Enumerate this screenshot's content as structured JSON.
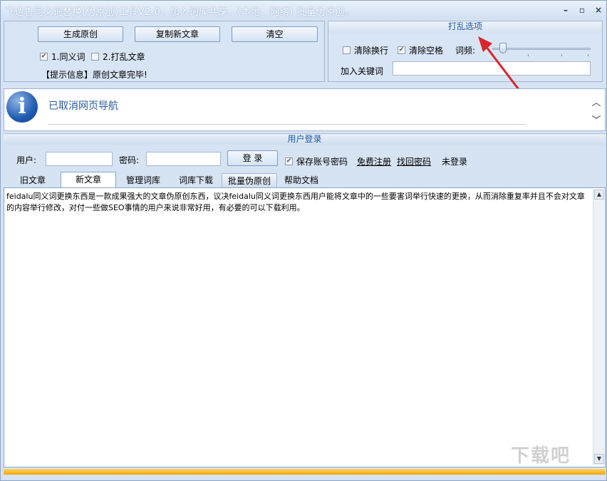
{
  "window": {
    "title": "飞达鲁同义词替换(伪原创)工具V2.0，加入词库共享、(本地、网络) 批量伪原创。",
    "minimize": "–",
    "maximize": "▫",
    "close": "×"
  },
  "actions": {
    "generate": "生成原创",
    "copy_new": "复制新文章",
    "clear": "清空"
  },
  "options": {
    "synonym_label": "1.同义词",
    "synonym_checked": true,
    "shuffle_label": "2.打乱文章",
    "shuffle_checked": false
  },
  "hint": "【提示信息】原创文章完毕!",
  "shuffle_panel": {
    "title": "打乱选项",
    "remove_newline": "清除换行",
    "remove_newline_checked": false,
    "remove_space": "清除空格",
    "remove_space_checked": true,
    "frequency_label": "词频:",
    "frequency_level": 0.1,
    "keyword_label": "加入关键词",
    "keyword_value": ""
  },
  "info": {
    "icon": "info-icon",
    "message": "已取消网页导航"
  },
  "login": {
    "header": "用户登录",
    "user_label": "用户:",
    "user_value": "",
    "password_label": "密码:",
    "password_value": "",
    "login_button": "登 录",
    "remember_label": "保存账号密码",
    "remember_checked": true,
    "register_link": "免费注册",
    "recover_link": "找回密码",
    "status": "未登录"
  },
  "tabs": [
    {
      "label": "旧文章"
    },
    {
      "label": "新文章",
      "active": true
    },
    {
      "label": "管理词库"
    },
    {
      "label": "词库下载"
    },
    {
      "label": "批量伪原创"
    },
    {
      "label": "帮助文档"
    }
  ],
  "content": {
    "text": "feidalu同义词更换东西是一款成果强大的文章伪原创东西，议决feidalu同义词更换东西用户能将文章中的一些要害词举行快速的更换，从而消除重复率并且不会对文章的内容举行修改，对付一些做SEO事情的用户来说非常好用，有必要的可以下载利用。"
  },
  "watermark": "下载吧"
}
